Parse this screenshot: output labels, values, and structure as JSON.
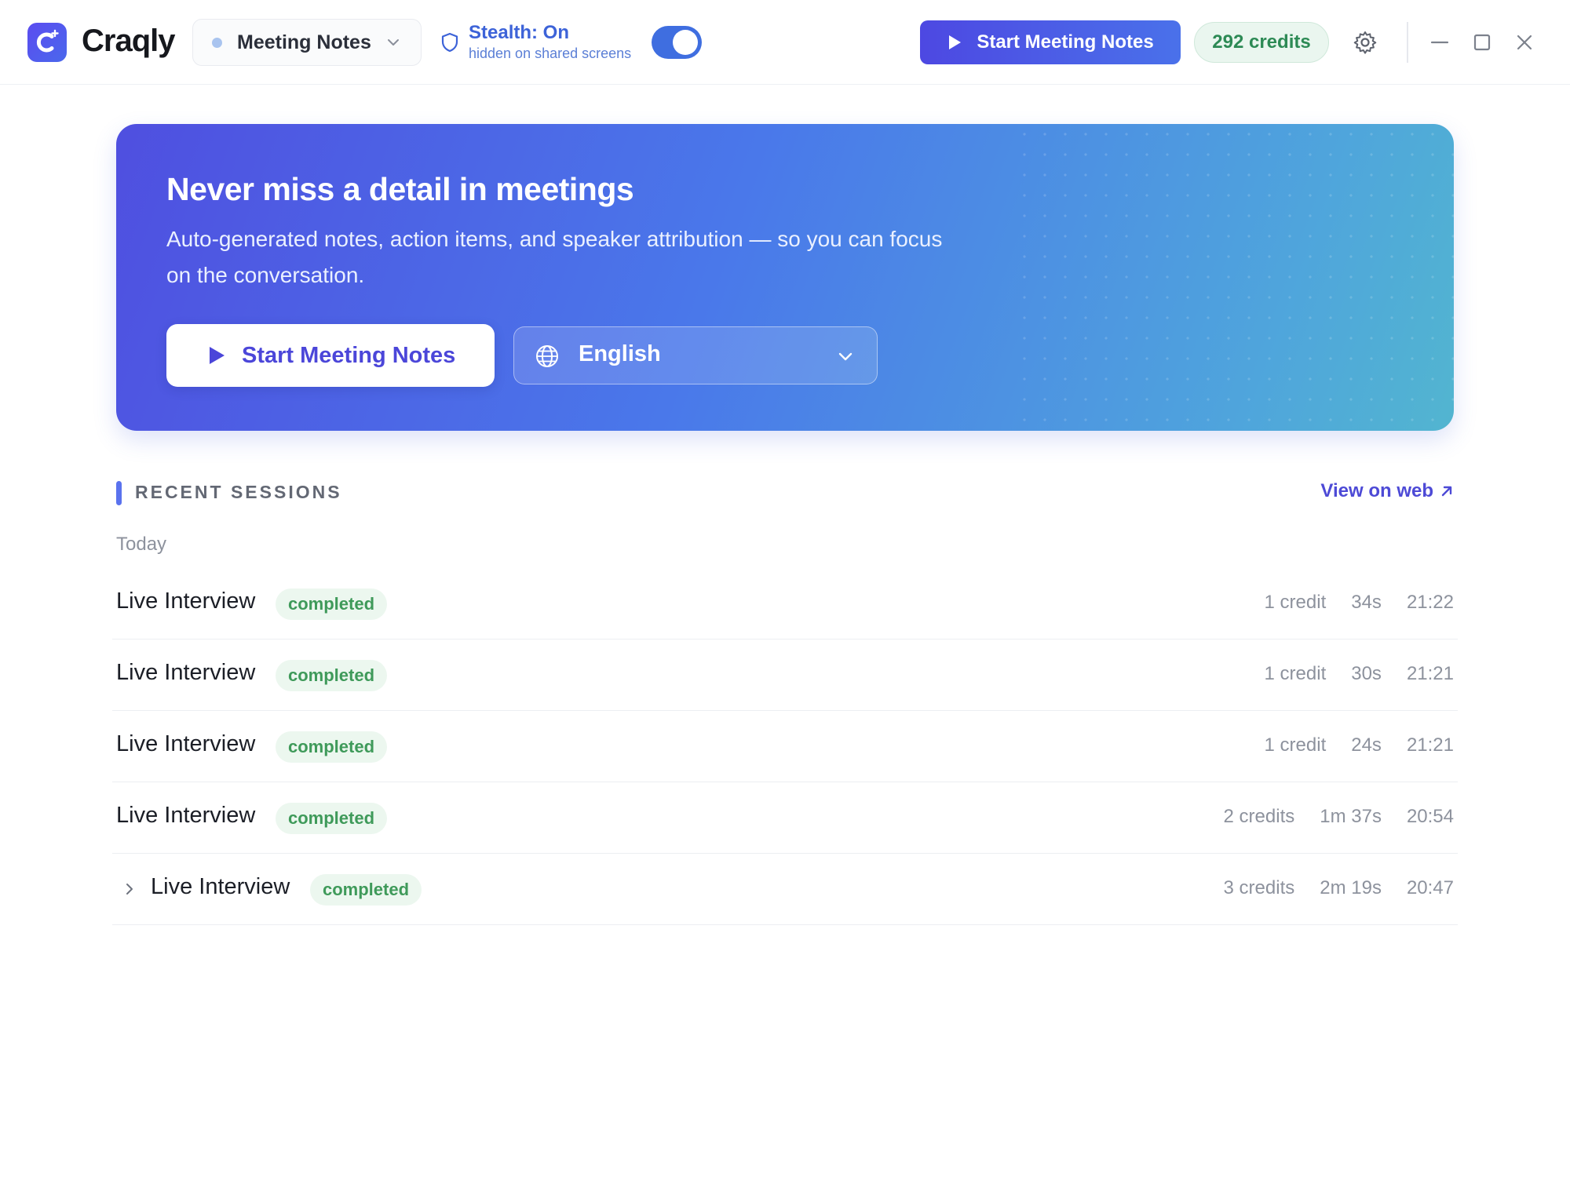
{
  "app": {
    "brand": "Craqly",
    "mode": "Meeting Notes",
    "stealth_title": "Stealth: On",
    "stealth_sub": "hidden on shared screens",
    "stealth_enabled": true,
    "start_button": "Start Meeting Notes",
    "credits": "292 credits"
  },
  "hero": {
    "title": "Never miss a detail in meetings",
    "description": "Auto-generated notes, action items, and speaker attribution — so you can focus on the conversation.",
    "start_button": "Start Meeting Notes",
    "language": "English"
  },
  "sessions": {
    "section_title": "RECENT SESSIONS",
    "view_web": "View on web",
    "group_label": "Today",
    "items": [
      {
        "title": "Live Interview",
        "status": "completed",
        "credits": "1 credit",
        "duration": "34s",
        "time": "21:22"
      },
      {
        "title": "Live Interview",
        "status": "completed",
        "credits": "1 credit",
        "duration": "30s",
        "time": "21:21"
      },
      {
        "title": "Live Interview",
        "status": "completed",
        "credits": "1 credit",
        "duration": "24s",
        "time": "21:21"
      },
      {
        "title": "Live Interview",
        "status": "completed",
        "credits": "2 credits",
        "duration": "1m 37s",
        "time": "20:54"
      },
      {
        "title": "Live Interview",
        "status": "completed",
        "credits": "3 credits",
        "duration": "2m 19s",
        "time": "20:47",
        "expandable": true
      }
    ]
  },
  "colors": {
    "accent": "#4d4ad6",
    "hero_start": "#4f4fe0",
    "hero_end": "#52b5d0",
    "success": "#3f9a5a"
  },
  "icons": {
    "logo": "craqly-logo-icon",
    "mode_chevron": "chevron-down-icon",
    "stealth": "shield-icon",
    "play": "play-icon",
    "settings": "gear-icon",
    "minimize": "minimize-icon",
    "maximize": "maximize-icon",
    "close": "close-icon",
    "language": "globe-icon",
    "external": "external-link-icon",
    "expand": "chevron-right-icon"
  }
}
